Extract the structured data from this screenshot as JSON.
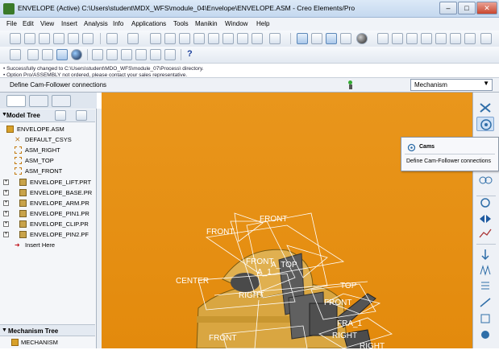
{
  "window": {
    "title": "ENVELOPE (Active) C:\\Users\\student\\MDX_WFS\\module_04\\Envelope\\ENVELOPE.ASM - Creo Elements/Pro",
    "minimize": "–",
    "maximize": "□",
    "close": "✕"
  },
  "menubar": [
    "File",
    "Edit",
    "View",
    "Insert",
    "Analysis",
    "Info",
    "Applications",
    "Tools",
    "Manikin",
    "Window",
    "Help"
  ],
  "messages": [
    "• Successfully changed to C:\\Users\\student\\MDO_WFS\\module_07\\Process\\ directory.",
    "• Option Pro/ASSEMBLY not ordered, please contact your sales representative."
  ],
  "status": {
    "text": "Define Cam-Follower connections",
    "filter_value": "Mechanism"
  },
  "model_tree": {
    "title": "Model Tree",
    "items": [
      {
        "label": "ENVELOPE.ASM",
        "icon": "assembly-icon",
        "indent": 0,
        "expand": false
      },
      {
        "label": "DEFAULT_CSYS",
        "icon": "csys-icon",
        "indent": 1,
        "expand": false
      },
      {
        "label": "ASM_RIGHT",
        "icon": "datum-plane-icon",
        "indent": 1,
        "expand": false
      },
      {
        "label": "ASM_TOP",
        "icon": "datum-plane-icon",
        "indent": 1,
        "expand": false
      },
      {
        "label": "ASM_FRONT",
        "icon": "datum-plane-icon",
        "indent": 1,
        "expand": false
      },
      {
        "label": "ENVELOPE_LIFT.PRT",
        "icon": "part-icon",
        "indent": 1,
        "expand": true
      },
      {
        "label": "ENVELOPE_BASE.PR",
        "icon": "part-icon",
        "indent": 1,
        "expand": true
      },
      {
        "label": "ENVELOPE_ARM.PR",
        "icon": "part-icon",
        "indent": 1,
        "expand": true
      },
      {
        "label": "ENVELOPE_PIN1.PR",
        "icon": "part-icon",
        "indent": 1,
        "expand": true
      },
      {
        "label": "ENVELOPE_CLIP.PR",
        "icon": "part-icon",
        "indent": 1,
        "expand": true
      },
      {
        "label": "ENVELOPE_PIN2.PF",
        "icon": "part-icon",
        "indent": 1,
        "expand": true
      },
      {
        "label": "Insert Here",
        "icon": "insert-arrow-icon",
        "indent": 1,
        "expand": false
      }
    ]
  },
  "mechanism_tree": {
    "title": "Mechanism Tree",
    "items": [
      "MECHANISM"
    ]
  },
  "viewport": {
    "background": "#e8921a",
    "labels": [
      "FRONT",
      "FRONT",
      "FRONT",
      "A_TOP",
      "A_1",
      "CENTER",
      "RIGHT",
      "TOP",
      "FRONT",
      "FRA_1",
      "RIGHT",
      "FRONT",
      "RIGHT"
    ]
  },
  "tooltip": {
    "title": "Cams",
    "description": "Define Cam-Follower connections"
  }
}
